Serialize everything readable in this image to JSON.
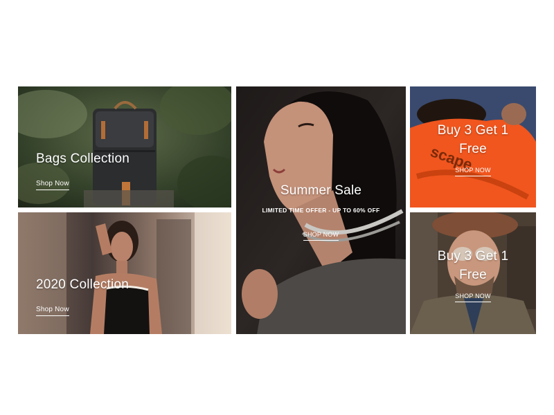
{
  "tiles": {
    "bags": {
      "title": "Bags Collection",
      "link": "Shop Now"
    },
    "collection2020": {
      "title": "2020 Collection",
      "link": "Shop Now"
    },
    "summer": {
      "title": "Summer Sale",
      "subtitle": "LIMITED TIME OFFER - UP TO 60% OFF",
      "link": "SHOP NOW"
    },
    "promo1": {
      "title_line1": "Buy 3 Get 1",
      "title_line2": "Free",
      "link": "SHOP NOW"
    },
    "promo2": {
      "title_line1": "Buy 3 Get 1",
      "title_line2": "Free",
      "link": "SHOP NOW"
    }
  },
  "colors": {
    "page_background": "#ffffff",
    "caption_text": "#ffffff",
    "orange_jacket": "#f0561e",
    "blue_wall": "#3a4a6e"
  }
}
